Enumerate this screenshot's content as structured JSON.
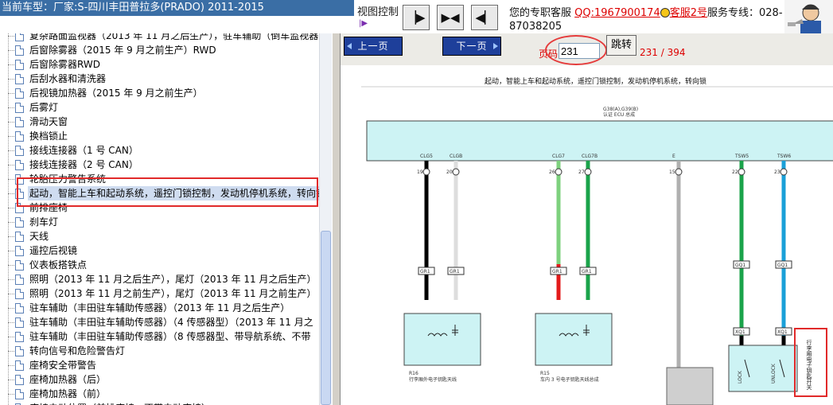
{
  "header": {
    "car_title": "当前车型：厂家:S-四川丰田普拉多(PRADO) 2011-2015",
    "view_control_label": "视图控制",
    "view_buttons": [
      "arrow-right-bar-icon",
      "arrows-inward-icon",
      "arrow-left-bar-icon"
    ],
    "service_prefix": "您的专职客服",
    "qq_link": "QQ:1967900174",
    "service2_link": "客服2号",
    "hotline": "服务专线：028-87038205"
  },
  "sidebar": {
    "items": [
      {
        "label": "复杂路面监视器（2013 年 11 月之后生产），驻车辅助（倒车监视器"
      },
      {
        "label": "后窗除雾器（2015 年 9 月之前生产）RWD"
      },
      {
        "label": "后窗除雾器RWD"
      },
      {
        "label": "后刮水器和清洗器"
      },
      {
        "label": "后视镜加热器（2015 年 9 月之前生产）"
      },
      {
        "label": "后雾灯"
      },
      {
        "label": "滑动天窗"
      },
      {
        "label": "换档锁止"
      },
      {
        "label": "接线连接器（1 号 CAN）"
      },
      {
        "label": "接线连接器（2 号 CAN）"
      },
      {
        "label": "轮胎压力警告系统"
      },
      {
        "label": "起动，智能上车和起动系统，遥控门锁控制，发动机停机系统，转向锁"
      },
      {
        "label": "前排座椅"
      },
      {
        "label": "刹车灯"
      },
      {
        "label": "天线"
      },
      {
        "label": "遥控后视镜"
      },
      {
        "label": "仪表板搭铁点"
      },
      {
        "label": "照明（2013 年 11 月之后生产），尾灯（2013 年 11 月之后生产）"
      },
      {
        "label": "照明（2013 年 11 月之前生产），尾灯（2013 年 11 月之前生产）"
      },
      {
        "label": "驻车辅助（丰田驻车辅助传感器）（2013 年 11 月之后生产）"
      },
      {
        "label": "驻车辅助（丰田驻车辅助传感器）（4 传感器型）（2013 年 11 月之"
      },
      {
        "label": "驻车辅助（丰田驻车辅助传感器）（8 传感器型、带导航系统、不带"
      },
      {
        "label": "转向信号和危险警告灯"
      },
      {
        "label": "座椅安全带警告"
      },
      {
        "label": "座椅加热器（后）"
      },
      {
        "label": "座椅加热器（前）"
      },
      {
        "label": "座椅电动位置（前排座椅，不带电动座椅）"
      }
    ],
    "selected_index": 11
  },
  "viewer": {
    "prev_label": "上一页",
    "next_label": "下一页",
    "page_label": "页码",
    "page_value": "231",
    "jump_label": "跳转",
    "page_count": "231 / 394"
  },
  "diagram": {
    "title": "起动，智能上车和起动系统，遥控门锁控制，发动机停机系统，转向锁",
    "ecu_id": "G38(A),G39(B)",
    "ecu_name": "认证 ECU 总成",
    "pins": [
      "CLG5",
      "CLGB",
      "CLG7",
      "CLG7B",
      "E",
      "TSW5",
      "TSW6"
    ],
    "pin_nums": [
      "19",
      "20",
      "26",
      "27",
      "15",
      "22",
      "23"
    ],
    "wire_colors": {
      "black": "#000000",
      "white": "#dddddd",
      "light_green": "#7ed17e",
      "green": "#1aa34a",
      "blue": "#1aa0d8",
      "red": "#e31b1b",
      "gray": "#b0b0b0"
    },
    "connectors": [
      "GR1",
      "GR1",
      "GR1",
      "GR1",
      "GQ1",
      "GQ1",
      "XQ1",
      "XQ1"
    ],
    "r16_label": "R16",
    "r16_desc": "行李厢外电子钥匙天线",
    "r15_label": "R15",
    "r15_desc": "车内 3 号电子钥匙天线总成",
    "switch_label": "行李厢电子钥匙开关",
    "lock_label": "LOCK",
    "unlock_label": "UNLOCK"
  }
}
